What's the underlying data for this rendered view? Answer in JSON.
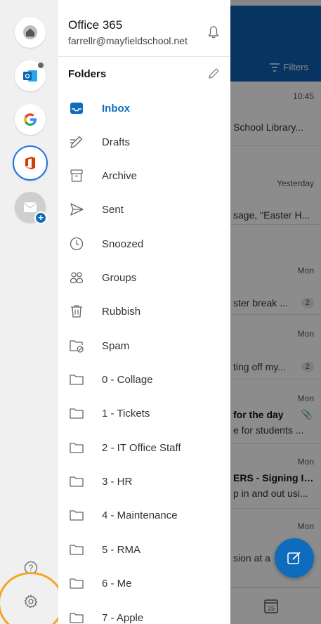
{
  "background": {
    "filters_label": "Filters",
    "mails": [
      {
        "time": "10:45",
        "snippet": "School Library...",
        "bold": false,
        "count": ""
      },
      {
        "time": "Yesterday",
        "snippet": "sage, \"Easter H...",
        "bold": false,
        "count": ""
      },
      {
        "time": "Mon",
        "snippet": "ster break ...",
        "bold": false,
        "count": "2"
      },
      {
        "time": "Mon",
        "snippet": "ting off my...",
        "bold": false,
        "count": "2"
      },
      {
        "time": "Mon",
        "snippet": "for the day",
        "snippet2": "e for students ...",
        "bold": true,
        "count": ""
      },
      {
        "time": "Mon",
        "snippet": "ERS - Signing In...",
        "snippet2": "p in and out usi...",
        "bold": true,
        "count": ""
      },
      {
        "time": "Mon",
        "snippet": "sion at a",
        "bold": false,
        "count": ""
      }
    ],
    "calendar_day": "25"
  },
  "rail": {
    "accounts": [
      {
        "name": "home-icon"
      },
      {
        "name": "outlook-icon"
      },
      {
        "name": "google-icon"
      },
      {
        "name": "office-icon"
      },
      {
        "name": "add-account-icon"
      }
    ],
    "help_icon": "question-icon",
    "settings_icon": "gear-icon"
  },
  "drawer": {
    "account_name": "Office 365",
    "account_email": "farrellr@mayfieldschool.net",
    "folders_heading": "Folders",
    "folders": [
      {
        "label": "Inbox",
        "icon": "inbox-icon",
        "active": true
      },
      {
        "label": "Drafts",
        "icon": "drafts-icon"
      },
      {
        "label": "Archive",
        "icon": "archive-icon"
      },
      {
        "label": "Sent",
        "icon": "sent-icon"
      },
      {
        "label": "Snoozed",
        "icon": "clock-icon"
      },
      {
        "label": "Groups",
        "icon": "groups-icon"
      },
      {
        "label": "Rubbish",
        "icon": "trash-icon"
      },
      {
        "label": "Spam",
        "icon": "spam-icon"
      },
      {
        "label": "0 - Collage",
        "icon": "folder-icon"
      },
      {
        "label": "1 - Tickets",
        "icon": "folder-icon"
      },
      {
        "label": "2 - IT Office Staff",
        "icon": "folder-icon"
      },
      {
        "label": "3 - HR",
        "icon": "folder-icon"
      },
      {
        "label": "4 - Maintenance",
        "icon": "folder-icon"
      },
      {
        "label": "5 - RMA",
        "icon": "folder-icon"
      },
      {
        "label": "6 - Me",
        "icon": "folder-icon"
      },
      {
        "label": "7 - Apple",
        "icon": "folder-icon"
      }
    ]
  },
  "colors": {
    "accent": "#0f6cbd",
    "header_blue": "#0f5fb3",
    "highlight_ring": "#f5a623",
    "office_red": "#d83b01"
  }
}
